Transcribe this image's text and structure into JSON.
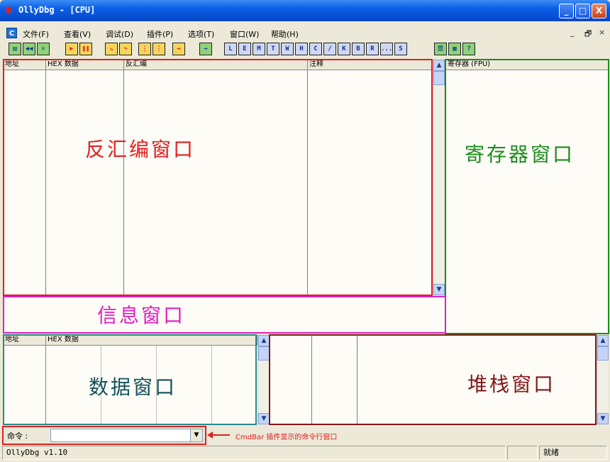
{
  "window": {
    "title": "OllyDbg - [CPU]",
    "minimize": "_",
    "maximize": "□",
    "close": "X"
  },
  "menu": {
    "items": [
      "文件(F)",
      "查看(V)",
      "调试(D)",
      "插件(P)",
      "选项(T)",
      "窗口(W)",
      "帮助(H)"
    ],
    "mdi_minimize": "_",
    "mdi_restore": "🗗",
    "mdi_close": "×"
  },
  "toolbar": {
    "letters": [
      "L",
      "E",
      "M",
      "T",
      "W",
      "H",
      "C",
      "/",
      "K",
      "B",
      "R",
      "...",
      "S"
    ]
  },
  "disasm": {
    "columns": [
      "地址",
      "HEX 数据",
      "反汇编",
      "注释"
    ],
    "label": "反汇编窗口"
  },
  "registers": {
    "header": "寄存器 (FPU)",
    "label": "寄存器窗口"
  },
  "info": {
    "label": "信息窗口"
  },
  "dump": {
    "columns": [
      "地址",
      "HEX 数据"
    ],
    "label": "数据窗口"
  },
  "stack": {
    "label": "堆栈窗口"
  },
  "cmdbar": {
    "label": "命令 :",
    "value": "",
    "annotation": "CmdBar 插件显示的命令行窗口"
  },
  "status": {
    "version": "OllyDbg v1.10",
    "state": "就绪"
  },
  "colors": {
    "disasm_frame": "#e02020",
    "disasm_label": "#e02020",
    "reg_frame": "#1e8a1e",
    "reg_label": "#1e8a1e",
    "info_frame": "#e020c0",
    "info_label": "#e020c0",
    "dump_frame": "#2a8a8a",
    "dump_label": "#12505a",
    "stack_frame": "#801818",
    "stack_label": "#801818",
    "cmd_frame": "#e02020",
    "arrow": "#e02020"
  }
}
